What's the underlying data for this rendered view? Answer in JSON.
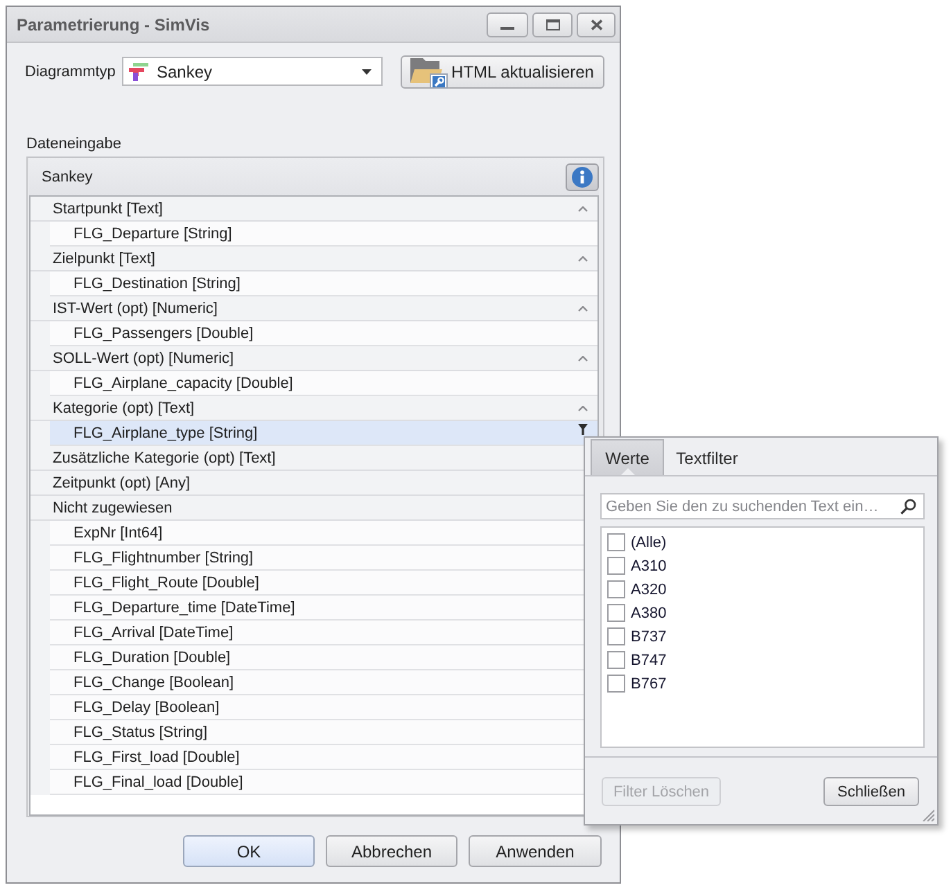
{
  "window": {
    "title": "Parametrierung - SimVis"
  },
  "diagram_type": {
    "label": "Diagrammtyp",
    "value": "Sankey"
  },
  "refresh_button": {
    "label": "HTML aktualisieren"
  },
  "data_input": {
    "label": "Dateneingabe",
    "panel_title": "Sankey",
    "groups": [
      {
        "label": "Startpunkt [Text]",
        "expanded": true,
        "children": [
          {
            "label": "FLG_Departure [String]",
            "selected": false
          }
        ]
      },
      {
        "label": "Zielpunkt [Text]",
        "expanded": true,
        "children": [
          {
            "label": "FLG_Destination [String]",
            "selected": false
          }
        ]
      },
      {
        "label": "IST-Wert (opt) [Numeric]",
        "expanded": true,
        "children": [
          {
            "label": "FLG_Passengers [Double]",
            "selected": false
          }
        ]
      },
      {
        "label": "SOLL-Wert (opt) [Numeric]",
        "expanded": true,
        "children": [
          {
            "label": "FLG_Airplane_capacity [Double]",
            "selected": false
          }
        ]
      },
      {
        "label": "Kategorie (opt) [Text]",
        "expanded": true,
        "children": [
          {
            "label": "FLG_Airplane_type [String]",
            "selected": true
          }
        ]
      },
      {
        "label": "Zusätzliche Kategorie (opt) [Text]"
      },
      {
        "label": "Zeitpunkt (opt) [Any]"
      },
      {
        "label": "Nicht zugewiesen",
        "children": [
          {
            "label": "ExpNr [Int64]",
            "selected": false
          },
          {
            "label": "FLG_Flightnumber [String]",
            "selected": false
          },
          {
            "label": "FLG_Flight_Route [Double]",
            "selected": false
          },
          {
            "label": "FLG_Departure_time [DateTime]",
            "selected": false
          },
          {
            "label": "FLG_Arrival [DateTime]",
            "selected": false
          },
          {
            "label": "FLG_Duration [Double]",
            "selected": false
          },
          {
            "label": "FLG_Change [Boolean]",
            "selected": false
          },
          {
            "label": "FLG_Delay [Boolean]",
            "selected": false
          },
          {
            "label": "FLG_Status [String]",
            "selected": false
          },
          {
            "label": "FLG_First_load [Double]",
            "selected": false
          },
          {
            "label": "FLG_Final_load [Double]",
            "selected": false
          }
        ]
      }
    ]
  },
  "buttons": [
    {
      "label": "OK",
      "default": true
    },
    {
      "label": "Abbrechen",
      "default": false
    },
    {
      "label": "Anwenden",
      "default": false
    }
  ],
  "filter_popup": {
    "tabs": [
      {
        "label": "Werte",
        "selected": true
      },
      {
        "label": "Textfilter",
        "selected": false
      }
    ],
    "search": {
      "placeholder": "Geben Sie den zu suchenden Text ein…"
    },
    "values": [
      {
        "label": "(Alle)",
        "checked": false
      },
      {
        "label": "A310",
        "checked": false
      },
      {
        "label": "A320",
        "checked": false
      },
      {
        "label": "A380",
        "checked": false
      },
      {
        "label": "B737",
        "checked": false
      },
      {
        "label": "B747",
        "checked": false
      },
      {
        "label": "B767",
        "checked": false
      }
    ],
    "buttons": [
      {
        "label": "Filter Löschen",
        "disabled": true
      },
      {
        "label": "Schließen",
        "disabled": false
      }
    ]
  }
}
